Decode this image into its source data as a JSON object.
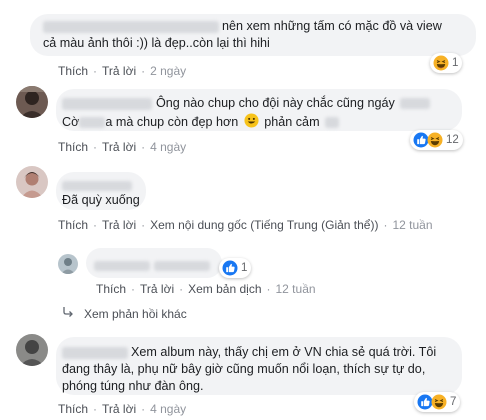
{
  "colors": {
    "bubble": "#f2f3f5",
    "link": "#4b4f56",
    "like": "#1877f2",
    "haha": "#f7b125"
  },
  "actions": {
    "like": "Thích",
    "reply": "Trả lời",
    "see_original": "Xem nội dung gốc",
    "see_translation": "Xem bản dịch"
  },
  "comments": [
    {
      "line1": "nên xem những tấm có mặc đồ và view",
      "line2": "cả màu ảnh thôi :)) là đẹp..còn lại thì hihi",
      "time": "2 ngày",
      "reactions": [
        "haha-icon"
      ],
      "reaction_count": "1"
    },
    {
      "line1": "Ông nào chup cho đội này chắc cũng ngáy",
      "line2_a": "Cờ",
      "line2_b": "a mà chup còn đẹp hơn",
      "emoji": "grinning-face-icon",
      "line2_c": "phản cảm",
      "time": "4 ngày",
      "reactions": [
        "like-icon",
        "haha-icon"
      ],
      "reaction_count": "12"
    },
    {
      "line1": "Đã quỳ xuống",
      "source_note": "(Tiếng Trung (Giản thể))",
      "time": "12 tuần"
    },
    {
      "time": "12 tuần",
      "reactions": [
        "like-icon"
      ],
      "reaction_count": "1"
    },
    {
      "line1": "Xem album này, thấy chị em ở VN chia sẻ quá trời. Tôi",
      "line2": "đang thây là, phụ nữ bây giờ cũng muốn nổi loạn, thích sự tự do,",
      "line3": "phóng túng như đàn ông.",
      "time": "4 ngày",
      "reactions": [
        "like-icon",
        "haha-icon"
      ],
      "reaction_count": "7"
    }
  ],
  "view_more_replies": "Xem phản hồi khác"
}
